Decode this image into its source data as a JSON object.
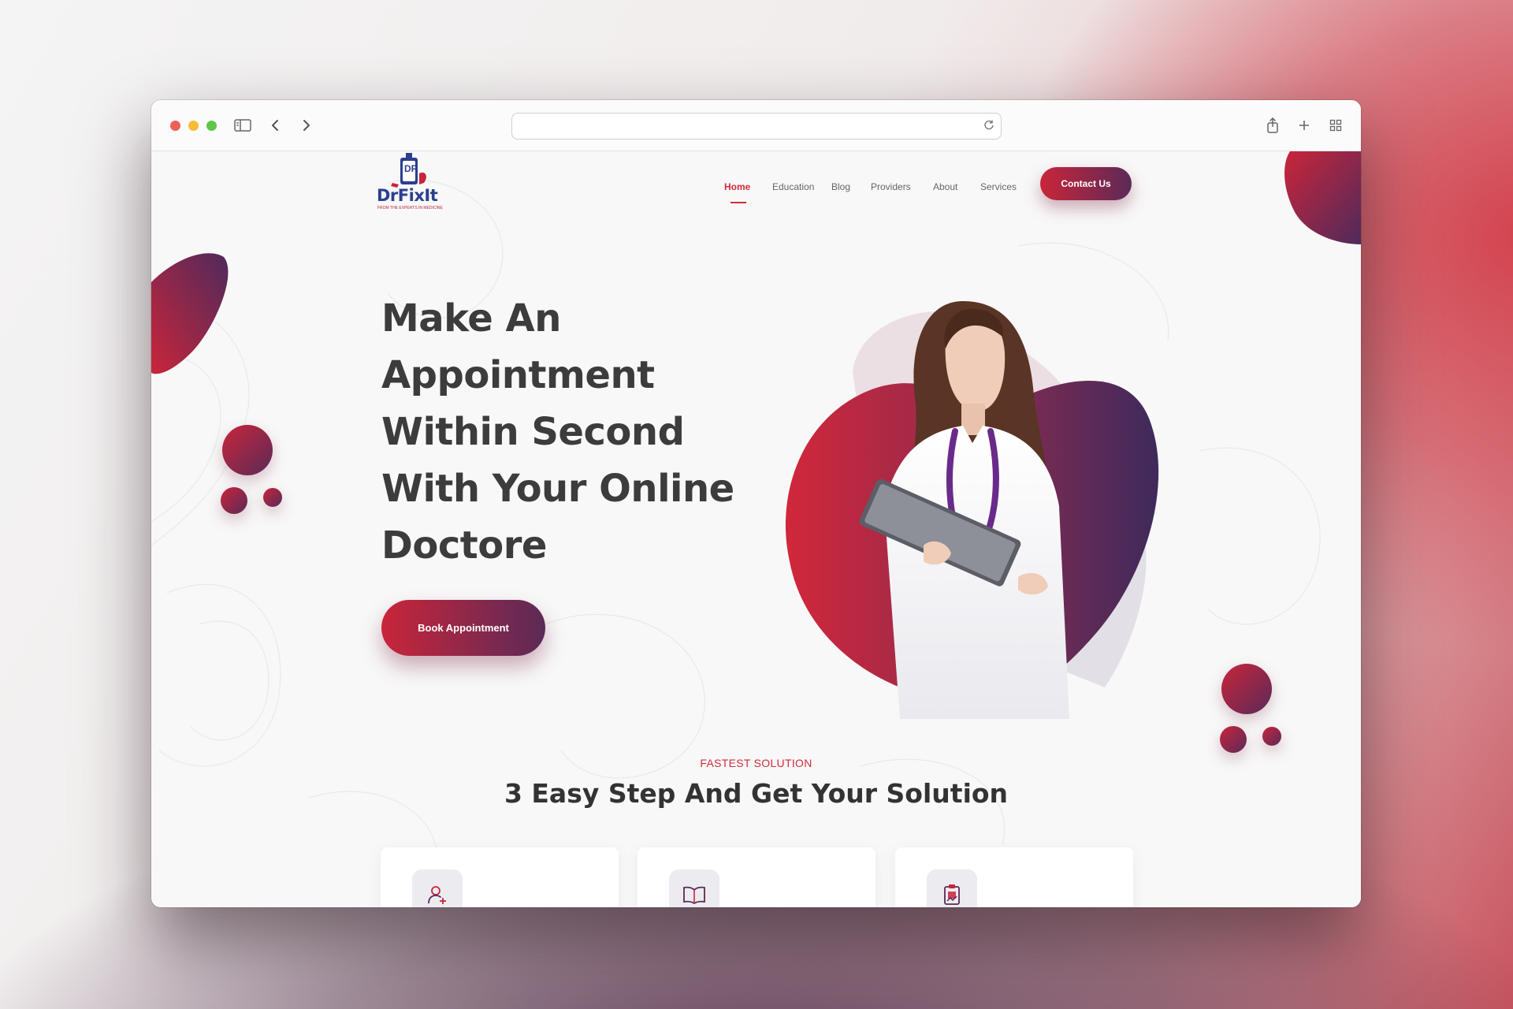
{
  "browser": {
    "url": ""
  },
  "site": {
    "logo_text": "DrFixIt",
    "logo_mark": "DF",
    "logo_tagline": "FROM THE EXPERTS IN MEDICINE"
  },
  "nav": {
    "items": [
      {
        "label": "Home"
      },
      {
        "label": "Education"
      },
      {
        "label": "Blog"
      },
      {
        "label": "Providers"
      },
      {
        "label": "About"
      },
      {
        "label": "Services"
      }
    ],
    "contact_label": "Contact Us"
  },
  "hero": {
    "title_lines": [
      "Make An",
      "Appointment",
      "Within Second",
      "With Your Online",
      "Doctore"
    ],
    "cta_label": "Book Appointment"
  },
  "steps": {
    "eyebrow": "FASTEST SOLUTION",
    "title": "3 Easy Step And Get Your Solution",
    "cards": [
      {
        "icon": "user-add-icon"
      },
      {
        "icon": "open-book-icon"
      },
      {
        "icon": "medical-report-icon"
      }
    ]
  },
  "colors": {
    "brand_red": "#c9253a",
    "brand_purple": "#5b2a57",
    "accent_text": "#d12b3d"
  }
}
